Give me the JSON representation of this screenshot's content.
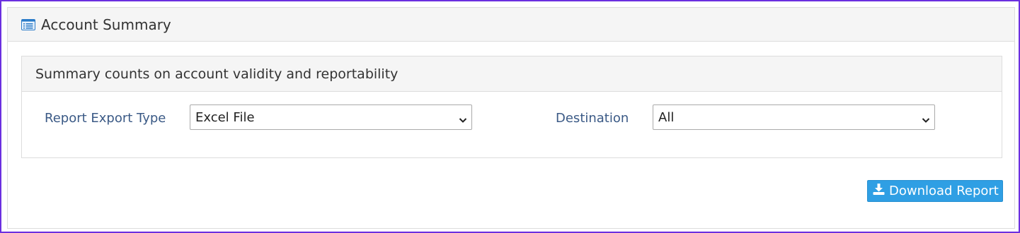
{
  "panel": {
    "title": "Account Summary",
    "icon": "list-icon"
  },
  "summary_section": {
    "heading": "Summary counts on account validity and reportability",
    "fields": {
      "export_type": {
        "label": "Report Export Type",
        "selected": "Excel File"
      },
      "destination": {
        "label": "Destination",
        "selected": "All"
      }
    }
  },
  "actions": {
    "download_label": "Download Report",
    "download_icon": "download-icon"
  },
  "colors": {
    "frame_border": "#6b2fe0",
    "label_text": "#3b5a86",
    "button_bg": "#2f9fe4",
    "heading_bg": "#f5f5f5"
  }
}
